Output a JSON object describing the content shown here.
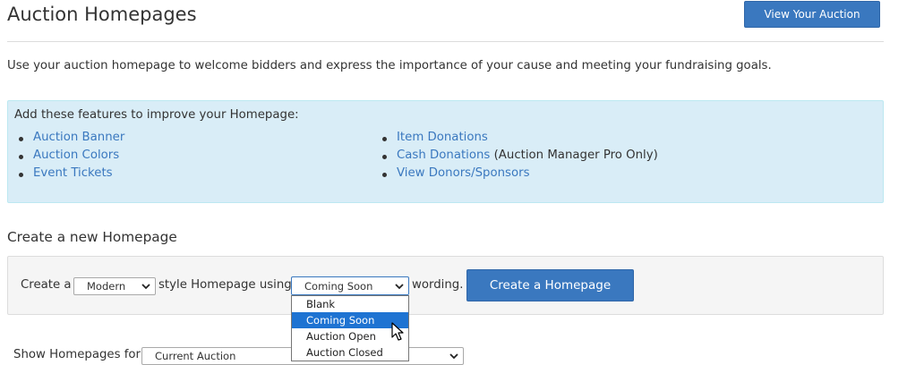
{
  "header": {
    "title": "Auction Homepages",
    "view_button_label": "View Your Auction"
  },
  "intro": "Use your auction homepage to welcome bidders and express the importance of your cause and meeting your fundraising goals.",
  "features": {
    "heading": "Add these features to improve your Homepage:",
    "left": [
      {
        "label": "Auction Banner"
      },
      {
        "label": "Auction Colors"
      },
      {
        "label": "Event Tickets"
      }
    ],
    "right": [
      {
        "label": "Item Donations",
        "note": ""
      },
      {
        "label": "Cash Donations",
        "note": "(Auction Manager Pro Only)"
      },
      {
        "label": "View Donors/Sponsors",
        "note": ""
      }
    ]
  },
  "create": {
    "heading": "Create a new Homepage",
    "prefix": "Create a",
    "style_value": "Modern",
    "middle": "style Homepage using",
    "wording_value": "Coming Soon",
    "suffix": "wording.",
    "button_label": "Create a Homepage",
    "wording_options": [
      {
        "label": "Blank",
        "selected": false
      },
      {
        "label": "Coming Soon",
        "selected": true
      },
      {
        "label": "Auction Open",
        "selected": false
      },
      {
        "label": "Auction Closed",
        "selected": false
      }
    ]
  },
  "show": {
    "label": "Show Homepages for",
    "value": "Current Auction"
  },
  "colors": {
    "accent": "#3a78bf",
    "info_bg": "#d9edf7",
    "option_highlight": "#1e73d2"
  }
}
